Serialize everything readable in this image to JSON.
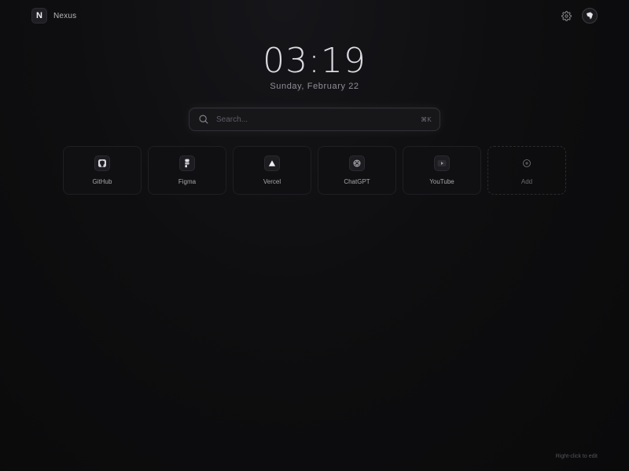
{
  "app": {
    "logo_letter": "N",
    "name": "Nexus"
  },
  "header": {
    "settings_icon": "gear-icon",
    "avatar_icon": "avatar-icon"
  },
  "clock": {
    "time": "03:19",
    "date": "Sunday, February 22"
  },
  "search": {
    "placeholder": "Search...",
    "value": "",
    "shortcut": "⌘K",
    "icon": "search-icon"
  },
  "shortcuts": [
    {
      "label": "GitHub",
      "icon": "github-icon"
    },
    {
      "label": "Figma",
      "icon": "figma-icon"
    },
    {
      "label": "Vercel",
      "icon": "vercel-icon"
    },
    {
      "label": "ChatGPT",
      "icon": "chatgpt-icon"
    },
    {
      "label": "YouTube",
      "icon": "youtube-icon"
    }
  ],
  "add_tile": {
    "label": "Add",
    "icon": "plus-circle-icon"
  },
  "footer": {
    "hint": "Right-click to edit"
  },
  "colors": {
    "background": "#0e0e10",
    "tile": "#101012",
    "text": "#d9d9de",
    "muted": "#8f8f96"
  }
}
